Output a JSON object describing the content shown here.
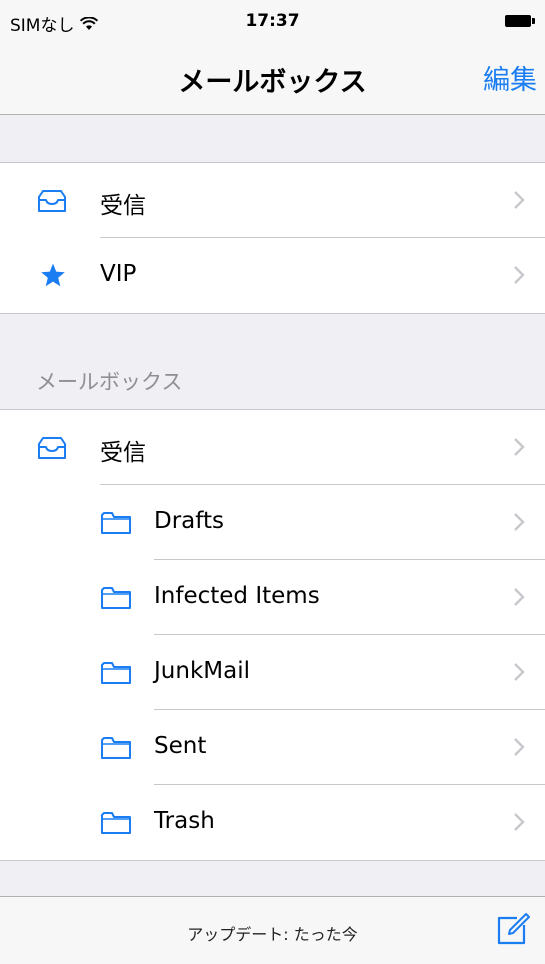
{
  "status_bar": {
    "carrier": "SIMなし",
    "time": "17:37"
  },
  "nav": {
    "title": "メールボックス",
    "edit_label": "編集"
  },
  "favorites": [
    {
      "label": "受信",
      "icon": "inbox-icon"
    },
    {
      "label": "VIP",
      "icon": "star-icon"
    }
  ],
  "mailboxes_header": "メールボックス",
  "mailboxes": {
    "inbox_label": "受信",
    "folders": [
      {
        "label": "Drafts",
        "icon": "folder-icon"
      },
      {
        "label": "Infected Items",
        "icon": "folder-icon"
      },
      {
        "label": "JunkMail",
        "icon": "folder-icon"
      },
      {
        "label": "Sent",
        "icon": "folder-icon"
      },
      {
        "label": "Trash",
        "icon": "folder-icon"
      }
    ]
  },
  "toolbar": {
    "update_status": "アップデート: たった今"
  },
  "colors": {
    "accent": "#1a7ef2",
    "background": "#efeff4",
    "separator": "#c8c7cc",
    "secondary_text": "#8e8e93"
  }
}
